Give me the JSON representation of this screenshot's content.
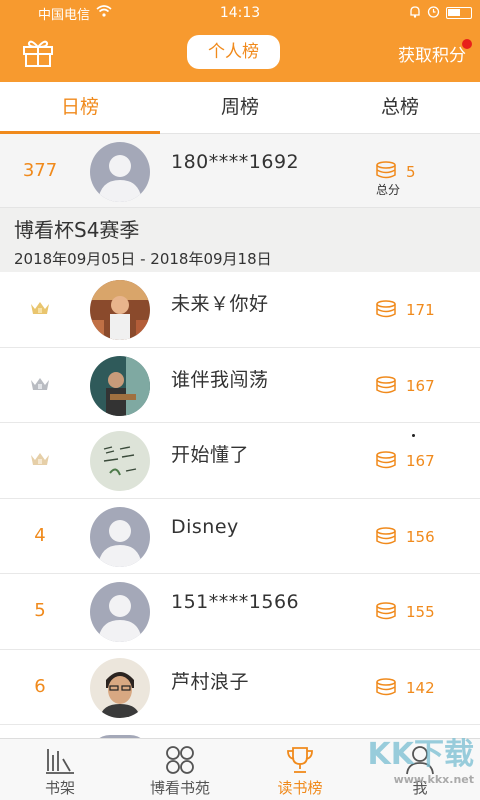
{
  "status": {
    "carrier": "中国电信",
    "time": "14:13"
  },
  "header": {
    "title": "个人榜",
    "earn_label": "获取积分"
  },
  "tabs": [
    {
      "label": "日榜"
    },
    {
      "label": "周榜"
    },
    {
      "label": "总榜"
    }
  ],
  "me": {
    "rank": "377",
    "name": "180****1692",
    "score": "5",
    "score_label": "总分"
  },
  "season": {
    "title": "博看杯S4赛季",
    "dates": "2018年09月05日 - 2018年09月18日"
  },
  "rows": [
    {
      "crown": "gold",
      "name": "未来￥你好",
      "score": "171"
    },
    {
      "crown": "silver",
      "name": "谁伴我闯荡",
      "score": "167"
    },
    {
      "crown": "bronze",
      "name": "开始懂了",
      "score": "167"
    },
    {
      "rank": "4",
      "name": "Disney",
      "score": "156"
    },
    {
      "rank": "5",
      "name": "151****1566",
      "score": "155"
    },
    {
      "rank": "6",
      "name": "芦村浪子",
      "score": "142"
    }
  ],
  "bottom_nav": [
    {
      "label": "书架",
      "icon": "bookshelf-icon"
    },
    {
      "label": "博看书苑",
      "icon": "clover-icon"
    },
    {
      "label": "读书榜",
      "icon": "trophy-icon"
    },
    {
      "label": "我",
      "icon": "person-icon"
    }
  ],
  "watermark": {
    "text": "KK下载",
    "url": "www.kkx.net"
  },
  "colors": {
    "accent": "#f79a2f",
    "highlight": "#f08a1c"
  }
}
